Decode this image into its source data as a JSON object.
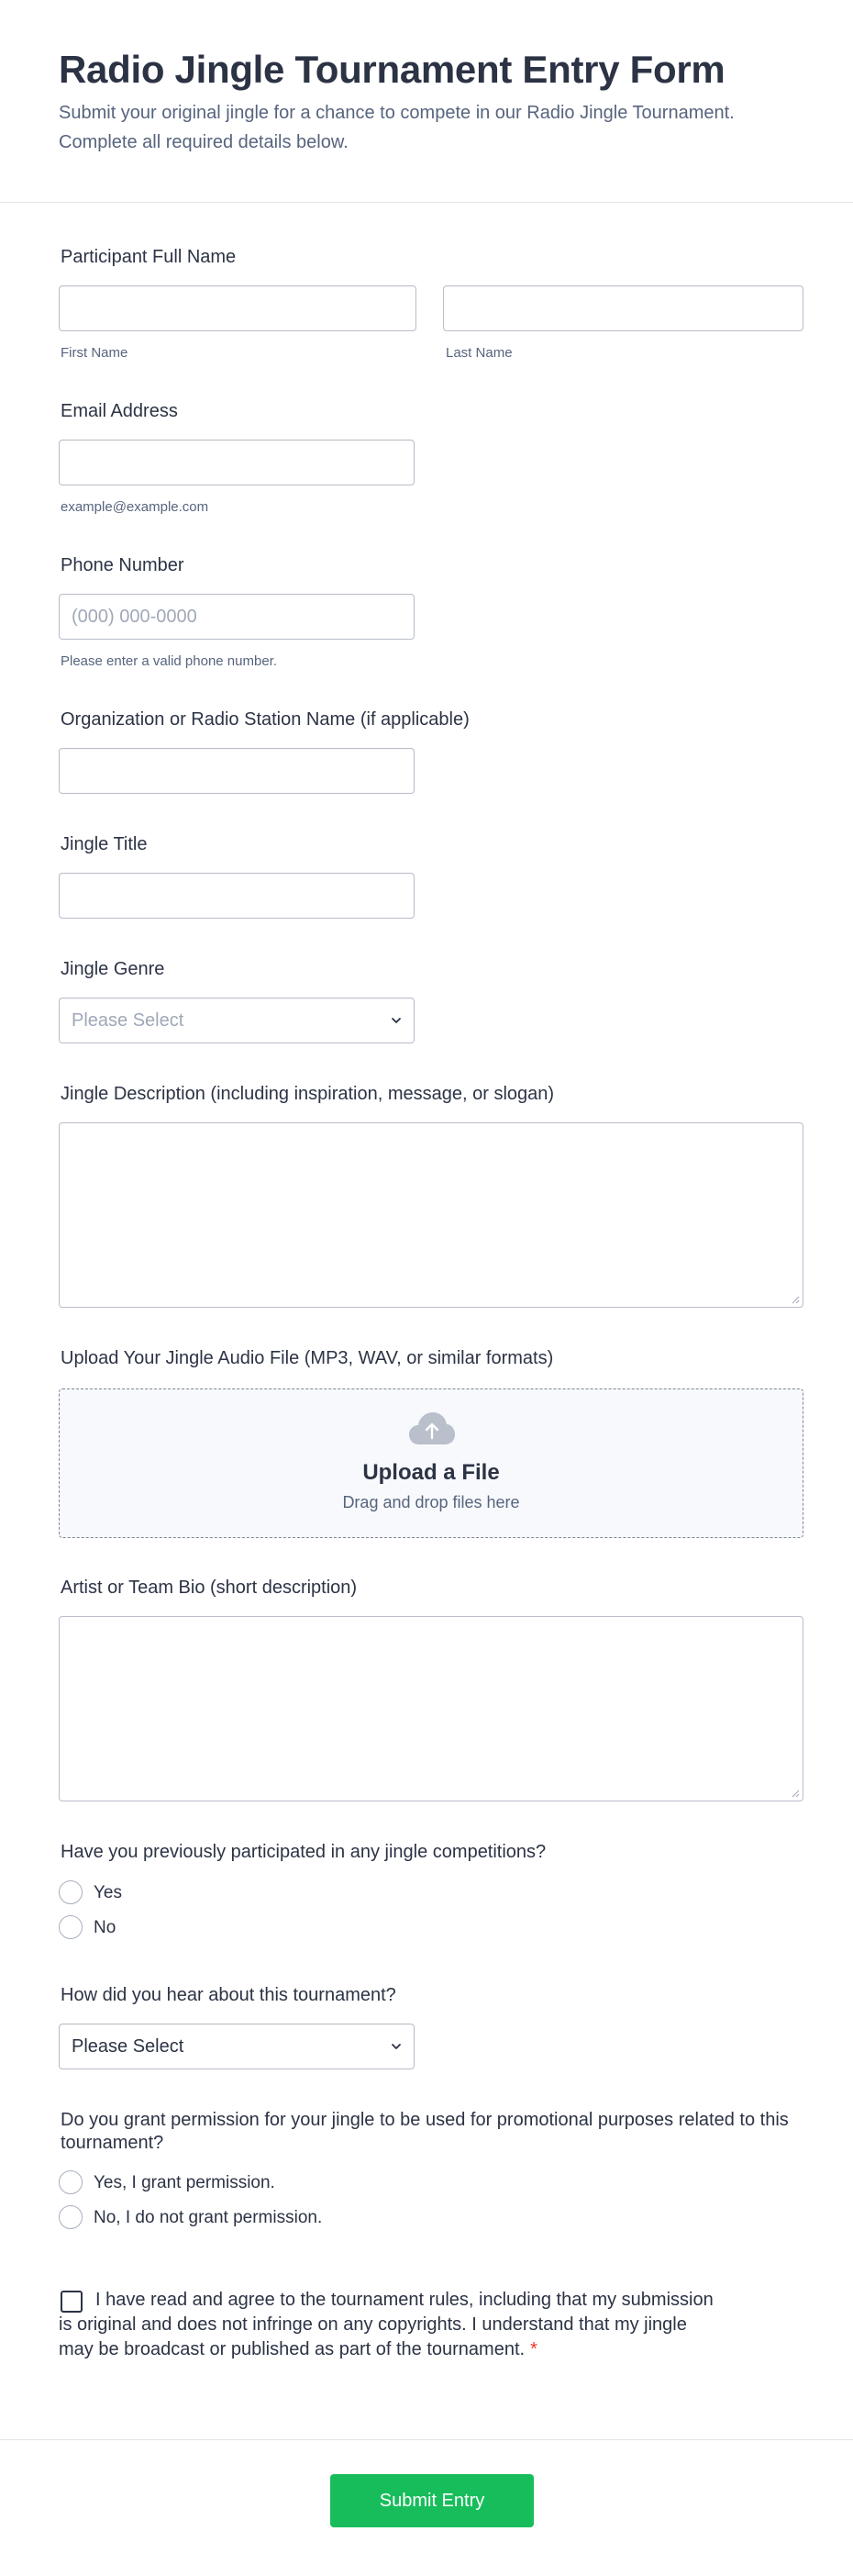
{
  "form": {
    "title": "Radio Jingle Tournament Entry Form",
    "subtitle": "Submit your original jingle for a chance to compete in our Radio Jingle Tournament. Complete all required details below."
  },
  "fields": {
    "name": {
      "label": "Participant Full Name",
      "first_sublabel": "First Name",
      "last_sublabel": "Last Name",
      "first_value": "",
      "last_value": ""
    },
    "email": {
      "label": "Email Address",
      "sublabel": "example@example.com",
      "value": ""
    },
    "phone": {
      "label": "Phone Number",
      "placeholder": "(000) 000-0000",
      "sublabel": "Please enter a valid phone number."
    },
    "organization": {
      "label": "Organization or Radio Station Name (if applicable)",
      "value": ""
    },
    "jingle_title": {
      "label": "Jingle Title",
      "value": ""
    },
    "genre": {
      "label": "Jingle Genre",
      "selected": "Please Select"
    },
    "description": {
      "label": "Jingle Description (including inspiration, message, or slogan)",
      "value": ""
    },
    "upload": {
      "label": "Upload Your Jingle Audio File (MP3, WAV, or similar formats)",
      "title": "Upload a File",
      "subtitle": "Drag and drop files here",
      "icon": "cloud-upload-icon"
    },
    "bio": {
      "label": "Artist or Team Bio (short description)",
      "value": ""
    },
    "previous": {
      "label": "Have you previously participated in any jingle competitions?",
      "options": [
        "Yes",
        "No"
      ]
    },
    "heard": {
      "label": "How did you hear about this tournament?",
      "selected": "Please Select"
    },
    "permission": {
      "label": "Do you grant permission for your jingle to be used for promotional purposes related to this tournament?",
      "options": [
        "Yes, I grant permission.",
        "No, I do not grant permission."
      ]
    },
    "consent": {
      "text": "I have read and agree to the tournament rules, including that my submission is original and does not infringe on any copyrights. I understand that my jingle may be broadcast or published as part of the tournament.",
      "required_mark": "*"
    }
  },
  "submit": {
    "label": "Submit Entry"
  },
  "colors": {
    "accent": "#18bd5b",
    "text": "#2c3345",
    "muted": "#57647e",
    "border": "#b8bdc9",
    "required": "#e43a2b"
  }
}
